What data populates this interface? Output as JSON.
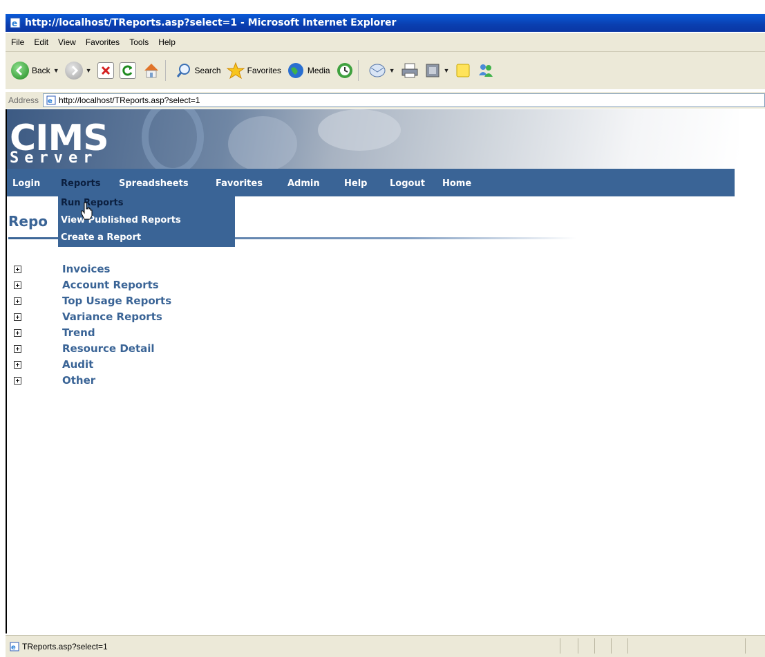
{
  "window": {
    "title": "http://localhost/TReports.asp?select=1 - Microsoft Internet Explorer"
  },
  "menu": [
    "File",
    "Edit",
    "View",
    "Favorites",
    "Tools",
    "Help"
  ],
  "toolbar": {
    "back": "Back",
    "search": "Search",
    "favorites": "Favorites",
    "media": "Media"
  },
  "address": {
    "label": "Address",
    "url": "http://localhost/TReports.asp?select=1"
  },
  "banner": {
    "logo_title": "CIMS",
    "logo_subtitle": "Server"
  },
  "nav": [
    "Login",
    "Reports",
    "Spreadsheets",
    "Favorites",
    "Admin",
    "Help",
    "Logout",
    "Home"
  ],
  "dropdown": [
    "Run Reports",
    "View Published Reports",
    "Create a Report"
  ],
  "heading": "Repo",
  "tree": [
    "Invoices",
    "Account Reports",
    "Top Usage Reports",
    "Variance Reports",
    "Trend",
    "Resource Detail",
    "Audit",
    "Other"
  ],
  "status": {
    "text": "TReports.asp?select=1"
  },
  "colors": {
    "nav_bg": "#3a6496",
    "link": "#3a6496",
    "title_bar": "#0a3fb0",
    "chrome": "#ece9d8"
  }
}
